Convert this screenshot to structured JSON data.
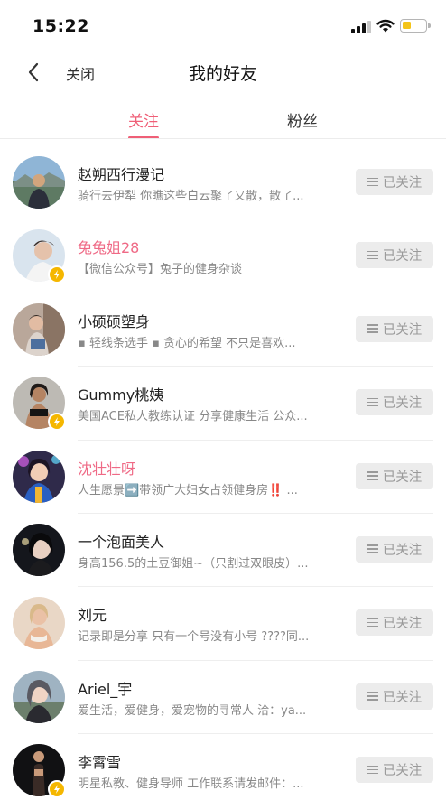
{
  "status_bar": {
    "time": "15:22"
  },
  "nav": {
    "close_label": "关闭",
    "title": "我的好友"
  },
  "tabs": [
    {
      "label": "关注",
      "active": true
    },
    {
      "label": "粉丝",
      "active": false
    }
  ],
  "colors": {
    "accent": "#ef5f77",
    "pink_name": "#ef6a86",
    "badge": "#f5b700",
    "button_bg": "#ececec"
  },
  "friends": [
    {
      "name": "赵朔西行漫记",
      "desc": "骑行去伊犁 你瞧这些白云聚了又散，散了...",
      "button": "已关注",
      "badge": false,
      "highlight": false
    },
    {
      "name": "兔兔姐28",
      "desc": "【微信公众号】兔子的健身杂谈",
      "button": "已关注",
      "badge": true,
      "highlight": true
    },
    {
      "name": "小硕硕塑身",
      "desc": "▪ 轻线条选手 ▪ 贪心的希望 不只是喜欢...",
      "button": "已关注",
      "badge": false,
      "highlight": false
    },
    {
      "name": "Gummy桃姨",
      "desc": "美国ACE私人教练认证 分享健康生活 公众...",
      "button": "已关注",
      "badge": true,
      "highlight": false
    },
    {
      "name": "沈壮壮呀",
      "desc": "人生愿景➡️带领广大妇女占领健身房‼️ ...",
      "button": "已关注",
      "badge": false,
      "highlight": true
    },
    {
      "name": "一个泡面美人",
      "desc": "身高156.5的土豆御姐~（只割过双眼皮）...",
      "button": "已关注",
      "badge": false,
      "highlight": false
    },
    {
      "name": "刘元",
      "desc": "记录即是分享 只有一个号没有小号 ????同...",
      "button": "已关注",
      "badge": false,
      "highlight": false
    },
    {
      "name": "Ariel_宇",
      "desc": "爱生活，爱健身，爱宠物的寻常人 洽：ya...",
      "button": "已关注",
      "badge": false,
      "highlight": false
    },
    {
      "name": "李霄雪",
      "desc": "明星私教、健身导师 工作联系请发邮件：...",
      "button": "已关注",
      "badge": true,
      "highlight": false
    }
  ]
}
